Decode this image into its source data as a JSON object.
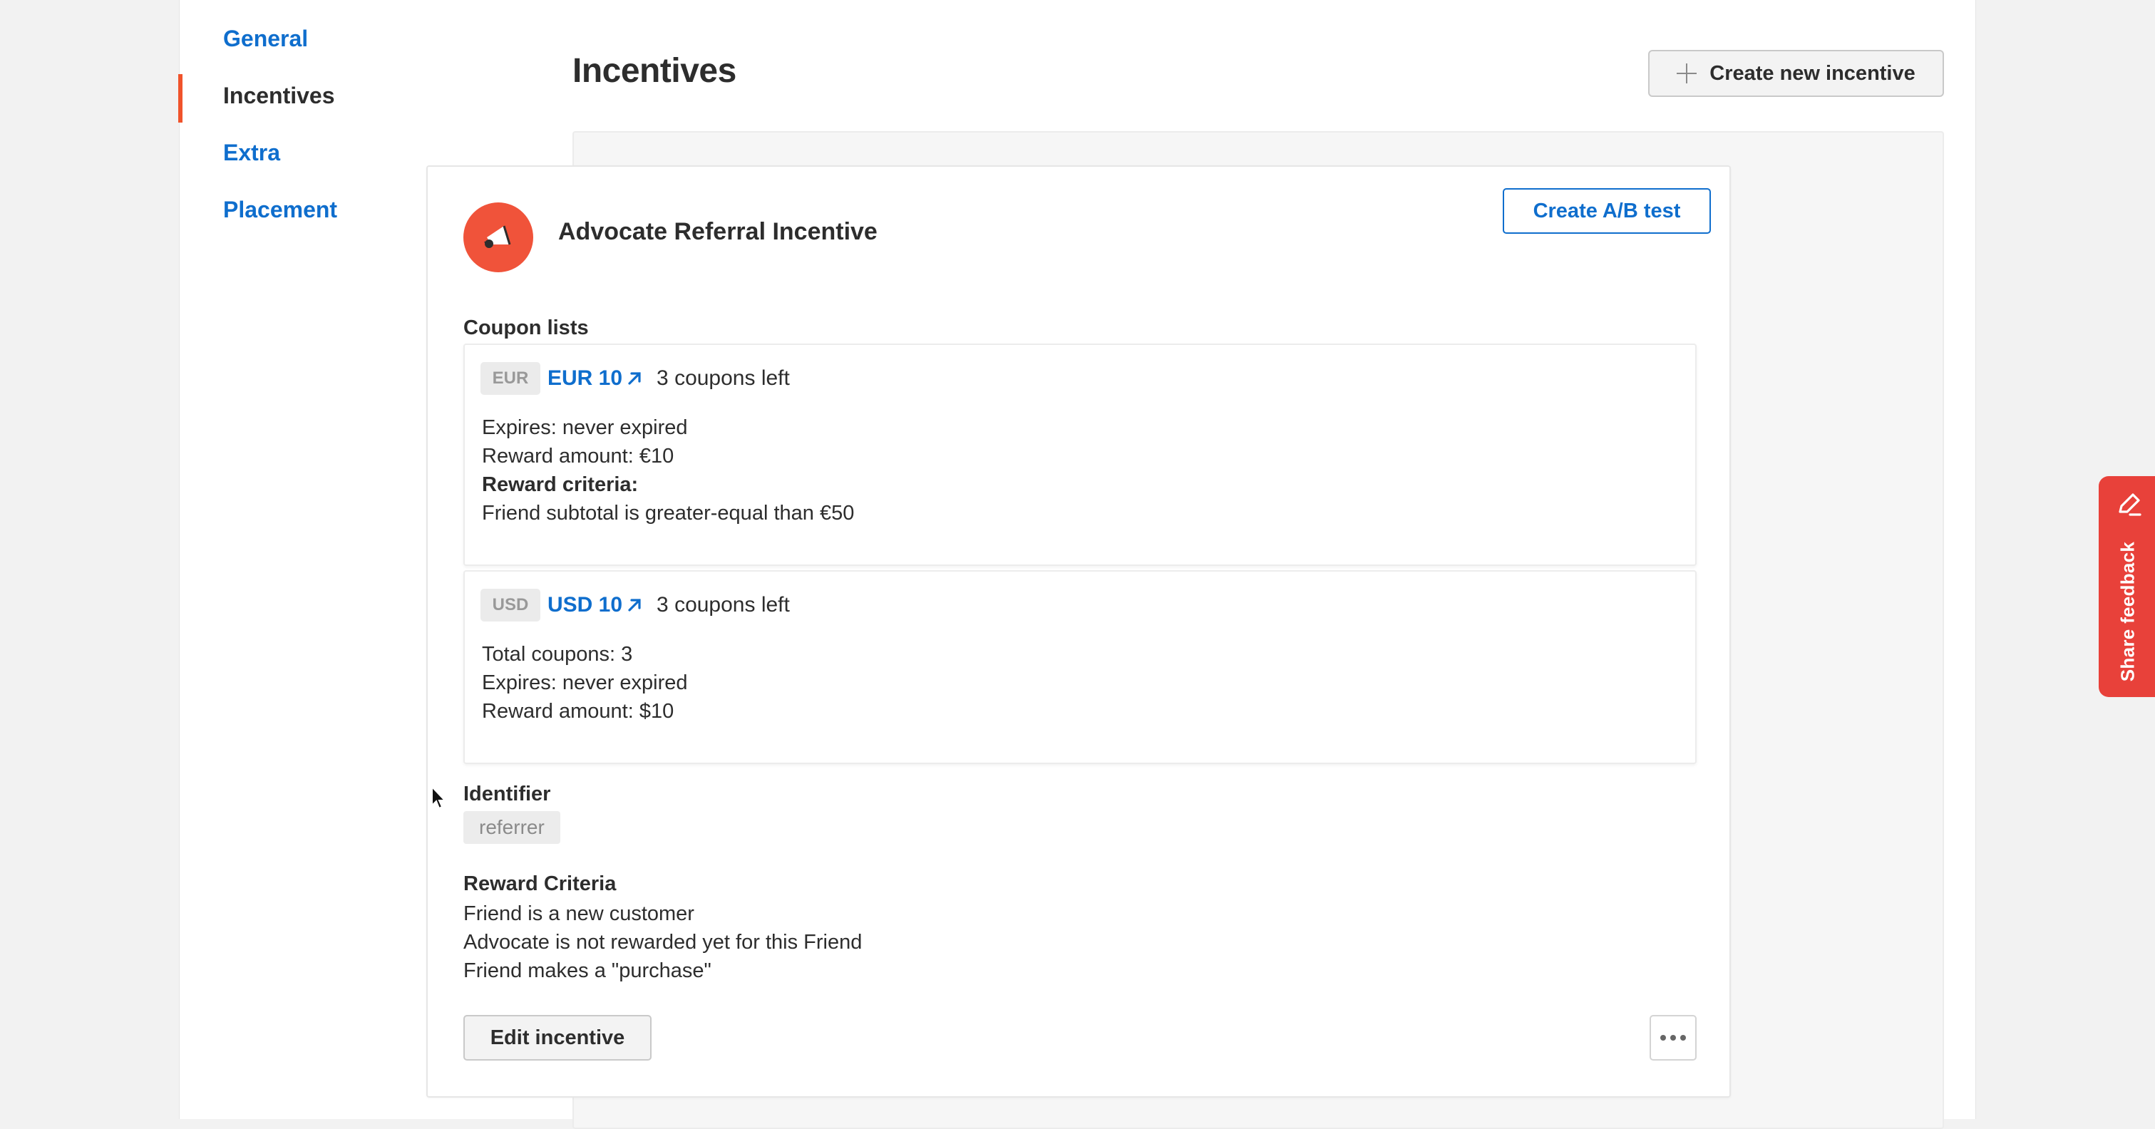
{
  "sidebar": {
    "items": [
      {
        "label": "General",
        "active": false
      },
      {
        "label": "Incentives",
        "active": true
      },
      {
        "label": "Extra",
        "active": false
      },
      {
        "label": "Placement",
        "active": false
      }
    ]
  },
  "header": {
    "title": "Incentives",
    "create_button": "Create new incentive"
  },
  "incentive": {
    "title": "Advocate Referral Incentive",
    "ab_test_button": "Create A/B test",
    "coupon_lists_label": "Coupon lists",
    "coupons": [
      {
        "currency": "EUR",
        "link": "EUR 10",
        "left": "3 coupons left",
        "lines": [
          "Expires: never expired",
          "Reward amount: €10"
        ],
        "criteria_label": "Reward criteria:",
        "criteria_text": "Friend subtotal is greater-equal than €50"
      },
      {
        "currency": "USD",
        "link": "USD 10",
        "left": "3 coupons left",
        "lines": [
          "Total coupons: 3",
          "Expires: never expired",
          "Reward amount: $10"
        ]
      }
    ],
    "identifier_label": "Identifier",
    "identifier_value": "referrer",
    "reward_criteria_label": "Reward Criteria",
    "reward_criteria": [
      "Friend is a new customer",
      "Advocate is not rewarded yet for this Friend",
      "Friend makes a \"purchase\""
    ],
    "edit_button": "Edit incentive"
  },
  "feedback": {
    "label": "Share feedback"
  },
  "colors": {
    "accent": "#0f6ecd",
    "active_indicator": "#f0532b",
    "avatar": "#f0533a",
    "feedback": "#e8413a"
  }
}
